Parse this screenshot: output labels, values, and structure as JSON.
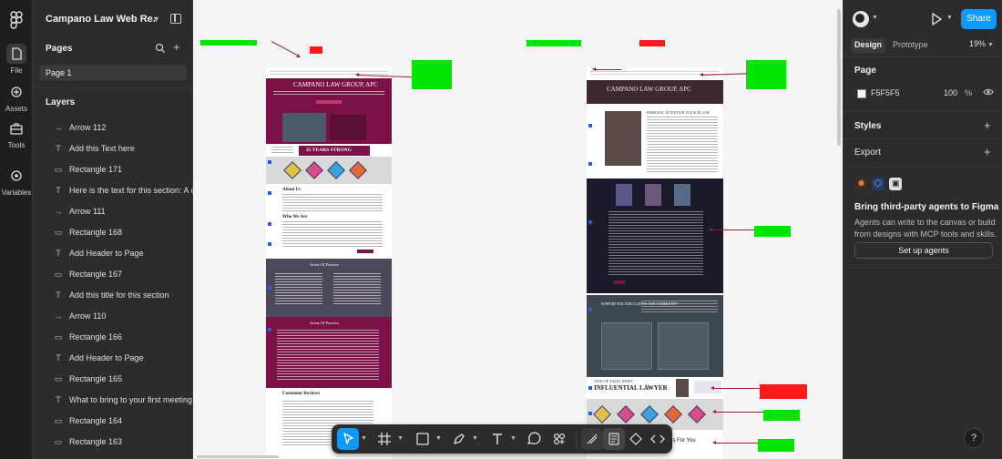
{
  "rail": {
    "items": [
      {
        "label": "File",
        "icon": "file-icon"
      },
      {
        "label": "Assets",
        "icon": "assets-icon"
      },
      {
        "label": "Tools",
        "icon": "tools-icon"
      },
      {
        "label": "Variables",
        "icon": "variables-icon"
      }
    ]
  },
  "file": {
    "title": "Campano Law Web Re..."
  },
  "pages": {
    "heading": "Pages",
    "items": [
      "Page 1"
    ]
  },
  "layers": {
    "heading": "Layers",
    "items": [
      {
        "type": "arrow",
        "name": "Arrow 112"
      },
      {
        "type": "text",
        "name": "Add this Text here"
      },
      {
        "type": "rect",
        "name": "Rectangle 171"
      },
      {
        "type": "text",
        "name": "Here is the text for this section: A co"
      },
      {
        "type": "arrow",
        "name": "Arrow 111"
      },
      {
        "type": "rect",
        "name": "Rectangle 168"
      },
      {
        "type": "text",
        "name": "Add Header to Page"
      },
      {
        "type": "rect",
        "name": "Rectangle 167"
      },
      {
        "type": "text",
        "name": "Add this title for this section"
      },
      {
        "type": "arrow",
        "name": "Arrow 110"
      },
      {
        "type": "rect",
        "name": "Rectangle 166"
      },
      {
        "type": "text",
        "name": "Add Header to Page"
      },
      {
        "type": "rect",
        "name": "Rectangle 165"
      },
      {
        "type": "text",
        "name": "What to bring to your first meeting"
      },
      {
        "type": "rect",
        "name": "Rectangle 164"
      },
      {
        "type": "rect",
        "name": "Rectangle 163"
      }
    ]
  },
  "canvas": {
    "left_frame": {
      "header": "CAMPANO LAW GROUP, APC",
      "banner": "25 YEARS STRONG",
      "about": "About Us",
      "who": "Who We Are",
      "areas1": "Areas Of Practice",
      "areas2": "Areas Of Practice",
      "reviews": "Consumer Reviews"
    },
    "right_frame": {
      "header": "CAMPANO LAW GROUP, APC",
      "personal": "PERSONAL ATTENTION TO EACH CASE",
      "support": "SUPPORT FOR OUR CLIENTS AND COMMUNITY",
      "influential_1": "ONE OF 2024'S MOST",
      "influential_2": "INFLUENTIAL LAWYER",
      "cities": "ties For You"
    }
  },
  "toolbar": {
    "tools": [
      "move-tool",
      "frame-tool",
      "shape-tool",
      "pen-tool",
      "text-tool",
      "comment-tool",
      "actions-tool",
      "draw-mode",
      "design-mode",
      "dev-mode",
      "code-mode"
    ]
  },
  "right": {
    "share": "Share",
    "tabs": [
      "Design",
      "Prototype"
    ],
    "zoom": "19%",
    "page_heading": "Page",
    "page_color": "F5F5F5",
    "opacity": "100",
    "opacity_unit": "%",
    "styles": "Styles",
    "export": "Export",
    "agents_title": "Bring third-party agents to Figma",
    "agents_desc": "Agents can write to the canvas or build from designs with MCP tools and skills.",
    "setup": "Set up agents",
    "help": "?"
  },
  "colors": {
    "accent": "#0d99ff",
    "maroon": "#7a1247",
    "note_green": "#00e600",
    "note_red": "#ff1a1a"
  }
}
